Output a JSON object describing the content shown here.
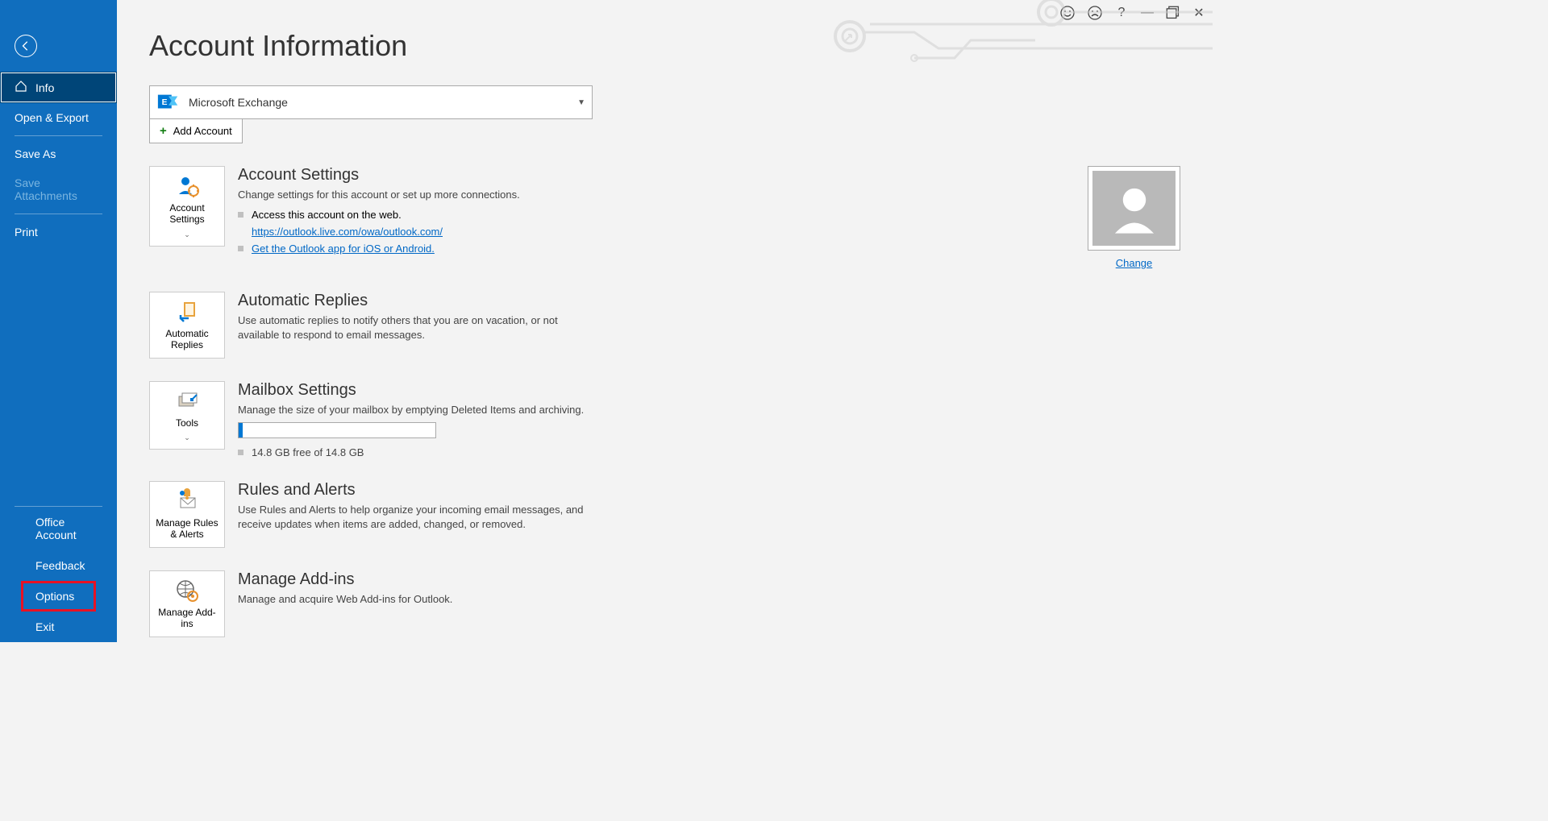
{
  "sidebar": {
    "items": [
      {
        "label": "Info",
        "selected": true,
        "icon": "home"
      },
      {
        "label": "Open & Export"
      },
      {
        "label": "Save As"
      },
      {
        "label": "Save Attachments",
        "disabled": true
      },
      {
        "label": "Print"
      }
    ],
    "bottom": [
      {
        "label": "Office Account"
      },
      {
        "label": "Feedback"
      },
      {
        "label": "Options",
        "highlight": true
      },
      {
        "label": "Exit"
      }
    ]
  },
  "titlebar": {
    "help": "?",
    "minimize": "—",
    "restore": "▢",
    "close": "✕"
  },
  "main": {
    "title": "Account Information",
    "account": {
      "name": "Microsoft Exchange",
      "add_label": "Add Account"
    },
    "sections": {
      "account_settings": {
        "btn": "Account Settings",
        "heading": "Account Settings",
        "desc": "Change settings for this account or set up more connections.",
        "bullets": [
          "Access this account on the web.",
          "https://outlook.live.com/owa/outlook.com/",
          "Get the Outlook app for iOS or Android."
        ],
        "change": "Change"
      },
      "auto_replies": {
        "btn": "Automatic Replies",
        "heading": "Automatic Replies",
        "desc": "Use automatic replies to notify others that you are on vacation, or not available to respond to email messages."
      },
      "mailbox": {
        "btn": "Tools",
        "heading": "Mailbox Settings",
        "desc": "Manage the size of your mailbox by emptying Deleted Items and archiving.",
        "free": "14.8 GB free of 14.8 GB"
      },
      "rules": {
        "btn": "Manage Rules & Alerts",
        "heading": "Rules and Alerts",
        "desc": "Use Rules and Alerts to help organize your incoming email messages, and receive updates when items are added, changed, or removed."
      },
      "addins": {
        "btn": "Manage Add-ins",
        "heading": "Manage Add-ins",
        "desc": "Manage and acquire Web Add-ins for Outlook."
      }
    }
  }
}
